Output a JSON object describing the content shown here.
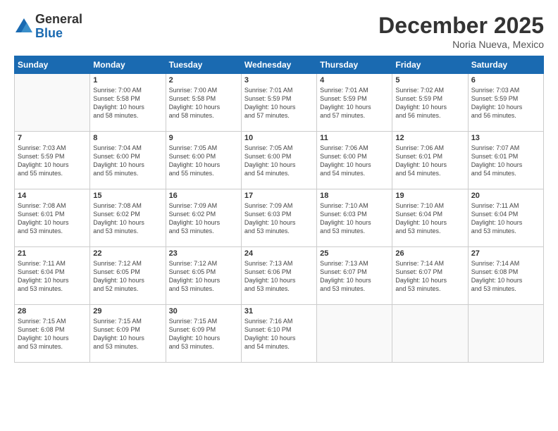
{
  "logo": {
    "general": "General",
    "blue": "Blue"
  },
  "header": {
    "month": "December 2025",
    "location": "Noria Nueva, Mexico"
  },
  "weekdays": [
    "Sunday",
    "Monday",
    "Tuesday",
    "Wednesday",
    "Thursday",
    "Friday",
    "Saturday"
  ],
  "weeks": [
    [
      {
        "day": "",
        "info": ""
      },
      {
        "day": "1",
        "info": "Sunrise: 7:00 AM\nSunset: 5:58 PM\nDaylight: 10 hours\nand 58 minutes."
      },
      {
        "day": "2",
        "info": "Sunrise: 7:00 AM\nSunset: 5:58 PM\nDaylight: 10 hours\nand 58 minutes."
      },
      {
        "day": "3",
        "info": "Sunrise: 7:01 AM\nSunset: 5:59 PM\nDaylight: 10 hours\nand 57 minutes."
      },
      {
        "day": "4",
        "info": "Sunrise: 7:01 AM\nSunset: 5:59 PM\nDaylight: 10 hours\nand 57 minutes."
      },
      {
        "day": "5",
        "info": "Sunrise: 7:02 AM\nSunset: 5:59 PM\nDaylight: 10 hours\nand 56 minutes."
      },
      {
        "day": "6",
        "info": "Sunrise: 7:03 AM\nSunset: 5:59 PM\nDaylight: 10 hours\nand 56 minutes."
      }
    ],
    [
      {
        "day": "7",
        "info": "Sunrise: 7:03 AM\nSunset: 5:59 PM\nDaylight: 10 hours\nand 55 minutes."
      },
      {
        "day": "8",
        "info": "Sunrise: 7:04 AM\nSunset: 6:00 PM\nDaylight: 10 hours\nand 55 minutes."
      },
      {
        "day": "9",
        "info": "Sunrise: 7:05 AM\nSunset: 6:00 PM\nDaylight: 10 hours\nand 55 minutes."
      },
      {
        "day": "10",
        "info": "Sunrise: 7:05 AM\nSunset: 6:00 PM\nDaylight: 10 hours\nand 54 minutes."
      },
      {
        "day": "11",
        "info": "Sunrise: 7:06 AM\nSunset: 6:00 PM\nDaylight: 10 hours\nand 54 minutes."
      },
      {
        "day": "12",
        "info": "Sunrise: 7:06 AM\nSunset: 6:01 PM\nDaylight: 10 hours\nand 54 minutes."
      },
      {
        "day": "13",
        "info": "Sunrise: 7:07 AM\nSunset: 6:01 PM\nDaylight: 10 hours\nand 54 minutes."
      }
    ],
    [
      {
        "day": "14",
        "info": "Sunrise: 7:08 AM\nSunset: 6:01 PM\nDaylight: 10 hours\nand 53 minutes."
      },
      {
        "day": "15",
        "info": "Sunrise: 7:08 AM\nSunset: 6:02 PM\nDaylight: 10 hours\nand 53 minutes."
      },
      {
        "day": "16",
        "info": "Sunrise: 7:09 AM\nSunset: 6:02 PM\nDaylight: 10 hours\nand 53 minutes."
      },
      {
        "day": "17",
        "info": "Sunrise: 7:09 AM\nSunset: 6:03 PM\nDaylight: 10 hours\nand 53 minutes."
      },
      {
        "day": "18",
        "info": "Sunrise: 7:10 AM\nSunset: 6:03 PM\nDaylight: 10 hours\nand 53 minutes."
      },
      {
        "day": "19",
        "info": "Sunrise: 7:10 AM\nSunset: 6:04 PM\nDaylight: 10 hours\nand 53 minutes."
      },
      {
        "day": "20",
        "info": "Sunrise: 7:11 AM\nSunset: 6:04 PM\nDaylight: 10 hours\nand 53 minutes."
      }
    ],
    [
      {
        "day": "21",
        "info": "Sunrise: 7:11 AM\nSunset: 6:04 PM\nDaylight: 10 hours\nand 53 minutes."
      },
      {
        "day": "22",
        "info": "Sunrise: 7:12 AM\nSunset: 6:05 PM\nDaylight: 10 hours\nand 52 minutes."
      },
      {
        "day": "23",
        "info": "Sunrise: 7:12 AM\nSunset: 6:05 PM\nDaylight: 10 hours\nand 53 minutes."
      },
      {
        "day": "24",
        "info": "Sunrise: 7:13 AM\nSunset: 6:06 PM\nDaylight: 10 hours\nand 53 minutes."
      },
      {
        "day": "25",
        "info": "Sunrise: 7:13 AM\nSunset: 6:07 PM\nDaylight: 10 hours\nand 53 minutes."
      },
      {
        "day": "26",
        "info": "Sunrise: 7:14 AM\nSunset: 6:07 PM\nDaylight: 10 hours\nand 53 minutes."
      },
      {
        "day": "27",
        "info": "Sunrise: 7:14 AM\nSunset: 6:08 PM\nDaylight: 10 hours\nand 53 minutes."
      }
    ],
    [
      {
        "day": "28",
        "info": "Sunrise: 7:15 AM\nSunset: 6:08 PM\nDaylight: 10 hours\nand 53 minutes."
      },
      {
        "day": "29",
        "info": "Sunrise: 7:15 AM\nSunset: 6:09 PM\nDaylight: 10 hours\nand 53 minutes."
      },
      {
        "day": "30",
        "info": "Sunrise: 7:15 AM\nSunset: 6:09 PM\nDaylight: 10 hours\nand 53 minutes."
      },
      {
        "day": "31",
        "info": "Sunrise: 7:16 AM\nSunset: 6:10 PM\nDaylight: 10 hours\nand 54 minutes."
      },
      {
        "day": "",
        "info": ""
      },
      {
        "day": "",
        "info": ""
      },
      {
        "day": "",
        "info": ""
      }
    ]
  ]
}
